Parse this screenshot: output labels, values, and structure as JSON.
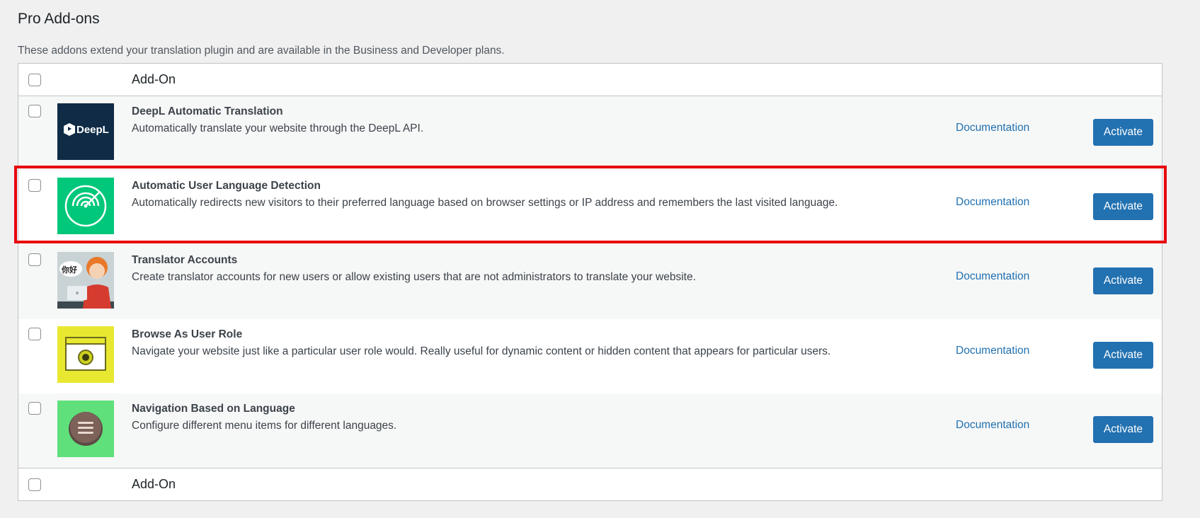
{
  "page": {
    "title": "Pro Add-ons",
    "description": "These addons extend your translation plugin and are available in the Business and Developer plans."
  },
  "table": {
    "header_label": "Add-On",
    "footer_label": "Add-On",
    "rows": [
      {
        "title": "DeepL Automatic Translation",
        "description": "Automatically translate your website through the DeepL API.",
        "doc_label": "Documentation",
        "button_label": "Activate",
        "thumb_text": "DeepL",
        "thumb_icon": "deepl-logo-icon",
        "thumb_color": "#0f2b46"
      },
      {
        "title": "Automatic User Language Detection",
        "description": "Automatically redirects new visitors to their preferred language based on browser settings or IP address and remembers the last visited language.",
        "doc_label": "Documentation",
        "button_label": "Activate",
        "thumb_icon": "radar-icon",
        "thumb_color": "#00c77a"
      },
      {
        "title": "Translator Accounts",
        "description": "Create translator accounts for new users or allow existing users that are not administrators to translate your website.",
        "doc_label": "Documentation",
        "button_label": "Activate",
        "thumb_text": "你好",
        "thumb_icon": "translator-person-icon",
        "thumb_color": "#c9d3d6"
      },
      {
        "title": "Browse As User Role",
        "description": "Navigate your website just like a particular user role would. Really useful for dynamic content or hidden content that appears for particular users.",
        "doc_label": "Documentation",
        "button_label": "Activate",
        "thumb_icon": "browser-eye-icon",
        "thumb_color": "#e8e831"
      },
      {
        "title": "Navigation Based on Language",
        "description": "Configure different menu items for different languages.",
        "doc_label": "Documentation",
        "button_label": "Activate",
        "thumb_icon": "menu-icon",
        "thumb_color": "#5fe07a"
      }
    ]
  },
  "colors": {
    "accent": "#2271b1",
    "highlight_border": "#e8060c"
  }
}
